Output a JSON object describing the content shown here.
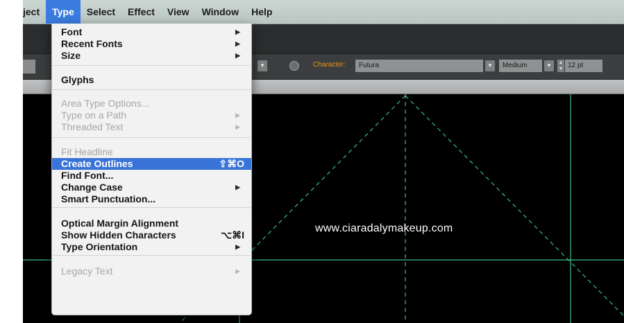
{
  "menubar": {
    "items": [
      "ject",
      "Type",
      "Select",
      "Effect",
      "View",
      "Window",
      "Help"
    ],
    "active_index": 1
  },
  "control_bar": {
    "character_label": "Character:",
    "font_value": "Futura",
    "weight_value": "Medium",
    "size_value": "12 pt"
  },
  "type_menu": {
    "items": [
      {
        "label": "Font",
        "submenu": true,
        "enabled": true
      },
      {
        "label": "Recent Fonts",
        "submenu": true,
        "enabled": true
      },
      {
        "label": "Size",
        "submenu": true,
        "enabled": true
      },
      {
        "label": "Glyphs",
        "enabled": true
      },
      {
        "label": "Area Type Options...",
        "enabled": false
      },
      {
        "label": "Type on a Path",
        "submenu": true,
        "enabled": false
      },
      {
        "label": "Threaded Text",
        "submenu": true,
        "enabled": false
      },
      {
        "label": "Fit Headline",
        "enabled": false
      },
      {
        "label": "Create Outlines",
        "shortcut": "⇧⌘O",
        "enabled": true,
        "highlighted": true
      },
      {
        "label": "Find Font...",
        "enabled": true
      },
      {
        "label": "Change Case",
        "submenu": true,
        "enabled": true
      },
      {
        "label": "Smart Punctuation...",
        "enabled": true
      },
      {
        "label": "Optical Margin Alignment",
        "enabled": true
      },
      {
        "label": "Show Hidden Characters",
        "shortcut": "⌥⌘I",
        "enabled": true
      },
      {
        "label": "Type Orientation",
        "submenu": true,
        "enabled": true
      },
      {
        "label": "Legacy Text",
        "submenu": true,
        "enabled": false
      }
    ]
  },
  "canvas": {
    "text": "www.ciaradalymakeup.com",
    "guide_color": "#3bbf86"
  }
}
